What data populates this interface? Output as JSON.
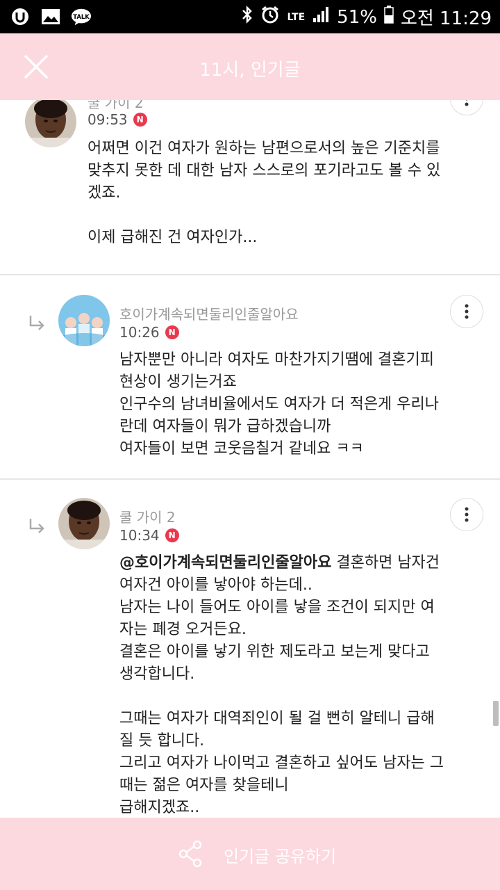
{
  "status_bar": {
    "network": "LTE",
    "battery": "51%",
    "time": "오전 11:29",
    "icons": [
      "u-plus-icon",
      "gallery-icon",
      "kakaotalk-icon",
      "bluetooth-icon",
      "alarm-icon",
      "signal-icon",
      "battery-icon"
    ],
    "talk_label": "TALK"
  },
  "header": {
    "title": "11시, 인기글",
    "close_icon": "close-icon",
    "background": "#fcd8df"
  },
  "comments": [
    {
      "author": "쿨 가이 2",
      "time": "09:53",
      "badge": "N",
      "text": "어쩌면 이건 여자가 원하는 남편으로서의 높은 기준치를\n맞추지 못한 데 대한 남자 스스로의 포기라고도 볼 수 있\n겠죠.\n\n이제 급해진 건 여자인가..."
    },
    {
      "author": "호이가계속되면둘리인줄알아요",
      "time": "10:26",
      "badge": "N",
      "text": "남자뿐만 아니라 여자도 마찬가지기땜에 결혼기피\n현상이 생기는거죠\n인구수의 남녀비율에서도 여자가 더 적은게 우리나\n란데 여자들이 뭐가 급하겠습니까\n여자들이 보면 코웃음칠거 같네요 ㅋㅋ"
    },
    {
      "author": "쿨 가이 2",
      "time": "10:34",
      "badge": "N",
      "mention": "@호이가계속되면둘리인줄알아요",
      "text": "  결혼하면 남자건\n여자건 아이를 낳아야 하는데..\n남자는 나이 들어도 아이를 낳을 조건이 되지만 여\n자는 폐경 오거든요.\n결혼은 아이를 낳기 위한 제도라고 보는게 맞다고\n생각합니다.\n\n그때는 여자가 대역죄인이 될 걸 뻔히 알테니 급해\n질 듯 합니다.\n그리고 여자가 나이먹고 결혼하고 싶어도 남자는 그\n때는 젊은 여자를 찾을테니\n급해지겠죠.."
    }
  ],
  "footer": {
    "share_label": "인기글 공유하기",
    "share_icon": "share-icon"
  },
  "colors": {
    "accent": "#fcd8df",
    "badge": "#e8394f"
  }
}
